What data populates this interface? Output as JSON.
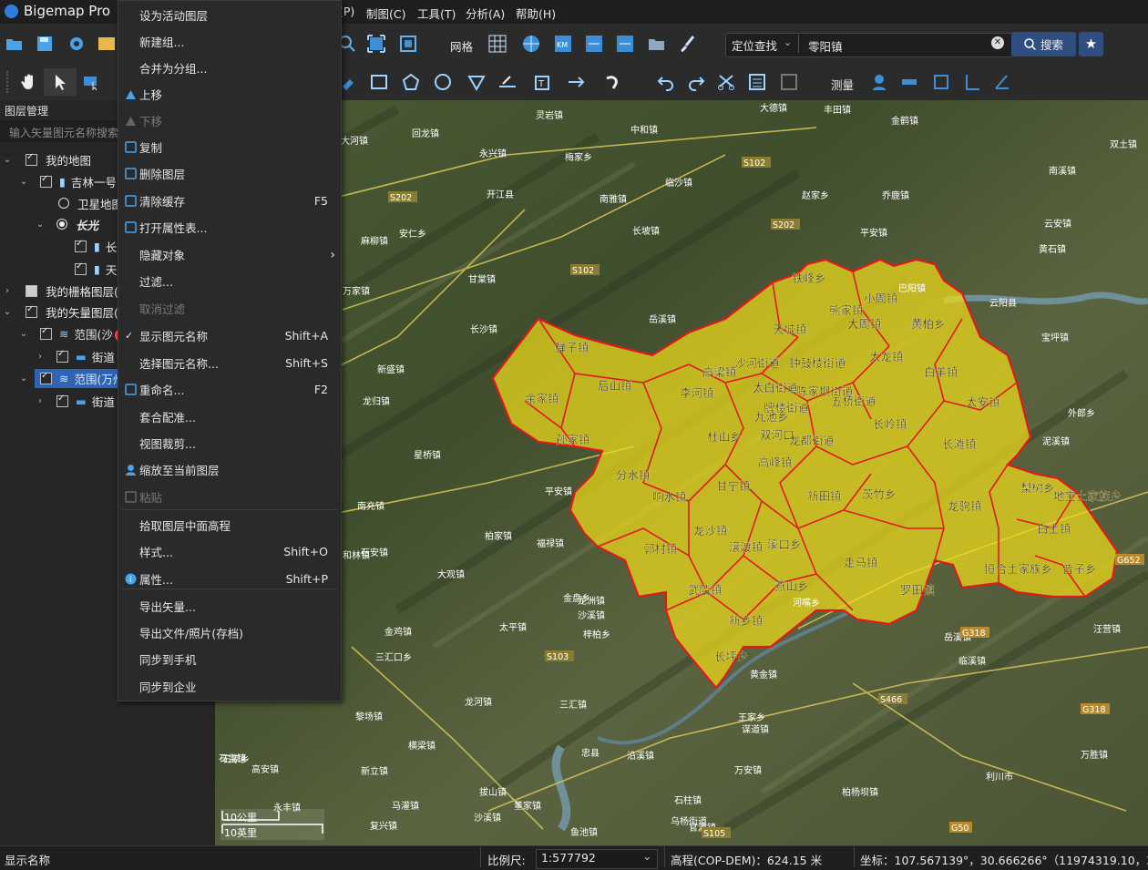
{
  "app": {
    "title": "Bigemap Pro"
  },
  "menubar": [
    "(P)",
    "制图(C)",
    "工具(T)",
    "分析(A)",
    "帮助(H)"
  ],
  "toolbar1": {
    "grid_label": "网格",
    "search_mode": "定位查找",
    "search_value": "零阳镇",
    "search_button": "搜索"
  },
  "toolbar2": {
    "measure_label": "测量"
  },
  "layer_panel": {
    "title": "图层管理",
    "search_placeholder": "输入矢量图元名称搜索",
    "tree": [
      {
        "label": "我的地图"
      },
      {
        "label": "吉林一号"
      },
      {
        "label": "卫星地图"
      },
      {
        "label": "长光"
      },
      {
        "label": "长"
      },
      {
        "label": "天"
      },
      {
        "label": "我的栅格图层(3"
      },
      {
        "label": "我的矢量图层(2"
      },
      {
        "label": "范围(沙"
      },
      {
        "label": "街道"
      },
      {
        "label": "范围(万州"
      },
      {
        "label": "街道"
      }
    ]
  },
  "context_menu": [
    {
      "label": "设为活动图层",
      "shortcut": ""
    },
    {
      "label": "新建组...",
      "shortcut": ""
    },
    {
      "label": "合并为分组...",
      "shortcut": ""
    },
    {
      "label": "上移",
      "shortcut": ""
    },
    {
      "label": "下移",
      "shortcut": ""
    },
    {
      "label": "复制",
      "shortcut": ""
    },
    {
      "label": "删除图层",
      "shortcut": ""
    },
    {
      "label": "清除缓存",
      "shortcut": "F5"
    },
    {
      "label": "打开属性表...",
      "shortcut": ""
    },
    {
      "label": "隐藏对象",
      "shortcut": ""
    },
    {
      "label": "过滤...",
      "shortcut": ""
    },
    {
      "label": "取消过滤",
      "shortcut": ""
    },
    {
      "label": "显示图元名称",
      "shortcut": "Shift+A"
    },
    {
      "label": "选择图元名称...",
      "shortcut": "Shift+S"
    },
    {
      "label": "重命名...",
      "shortcut": "F2"
    },
    {
      "label": "套合配准...",
      "shortcut": ""
    },
    {
      "label": "视图裁剪...",
      "shortcut": ""
    },
    {
      "label": "缩放至当前图层",
      "shortcut": ""
    },
    {
      "label": "粘贴",
      "shortcut": ""
    },
    {
      "label": "拾取图层中面高程",
      "shortcut": ""
    },
    {
      "label": "样式...",
      "shortcut": "Shift+O"
    },
    {
      "label": "属性...",
      "shortcut": "Shift+P"
    },
    {
      "label": "导出矢量...",
      "shortcut": ""
    },
    {
      "label": "导出文件/照片(存档)",
      "shortcut": ""
    },
    {
      "label": "同步到手机",
      "shortcut": ""
    },
    {
      "label": "同步到企业",
      "shortcut": ""
    }
  ],
  "map": {
    "region_labels": [
      "铁峰乡",
      "熊家镇",
      "小周镇",
      "天城镇",
      "大周镇",
      "黄柏乡",
      "弹子镇",
      "太龙镇",
      "沙河街道",
      "钟鼓楼街道",
      "高梁镇",
      "白羊镇",
      "后山镇",
      "余家镇",
      "李河镇",
      "太白街道",
      "陈家坝街道",
      "五桥街道",
      "太安镇",
      "牌楼街道",
      "九池乡",
      "长岭镇",
      "孙家镇",
      "杜山乡",
      "双河口",
      "龙都街道",
      "长滩镇",
      "高峰镇",
      "分水镇",
      "甘宁镇",
      "新田镇",
      "茨竹乡",
      "响水镇",
      "龙驹镇",
      "梨树乡",
      "地宝土家族乡",
      "龙沙镇",
      "瀼渡镇",
      "溪口乡",
      "郭村镇",
      "白土镇",
      "走马镇",
      "恒合土家族乡",
      "普子乡",
      "武陵镇",
      "燕山乡",
      "罗田镇",
      "新乡镇",
      "长坪乡"
    ],
    "base_labels": [
      "灵岩镇",
      "大德镇",
      "丰田镇",
      "回龙镇",
      "中和镇",
      "金鹤镇",
      "永兴镇",
      "梅家乡",
      "双土镇",
      "南溪镇",
      "开江县",
      "临沙镇",
      "南雅镇",
      "赵家乡",
      "乔鹿镇",
      "大河镇",
      "安仁乡",
      "长坡镇",
      "平安镇",
      "云安镇",
      "麻柳镇",
      "黄石镇",
      "万家镇",
      "巴阳镇",
      "云阳县",
      "甘棠镇",
      "岳溪镇",
      "宝坪镇",
      "长沙镇",
      "新盛镇",
      "龙归镇",
      "外郎乡",
      "泥溪镇",
      "星桥镇",
      "平安镇",
      "南充镇",
      "福禄镇",
      "石安镇",
      "柏家镇",
      "和林镇",
      "大观镇",
      "金盘乡",
      "龙洲镇",
      "金鸡镇",
      "沙溪镇",
      "梓柏乡",
      "河嘴乡",
      "太平镇",
      "龙河镇",
      "三汇镇",
      "黄金镇",
      "临溪镇",
      "谋道镇",
      "万安镇",
      "王家乡",
      "岳溪镇",
      "石家乡",
      "高安镇",
      "石柱镇",
      "沿溪镇",
      "忠县",
      "鱼池镇",
      "乌杨街道",
      "万胜镇",
      "利川市",
      "汪营镇",
      "柏杨坝镇",
      "横梁镇",
      "石宝镇",
      "新立镇",
      "马灌镇",
      "董家镇",
      "拔山镇",
      "黎场镇",
      "三汇口乡",
      "复兴镇",
      "沙溪镇",
      "官渡镇",
      "永丰镇"
    ],
    "road_labels": [
      "S102",
      "S202",
      "S202",
      "S102",
      "S103",
      "S105",
      "G318",
      "G318",
      "G50",
      "S466",
      "G652"
    ],
    "scale_km": "10公里",
    "scale_mi": "10英里"
  },
  "statusbar": {
    "left": "显示名称",
    "scale_label": "比例尺:",
    "scale_value": "1:577792",
    "elevation": "高程(COP-DEM)：624.15 米",
    "coords": "坐标：107.567139°，30.666266°（11974319.10，358948"
  }
}
